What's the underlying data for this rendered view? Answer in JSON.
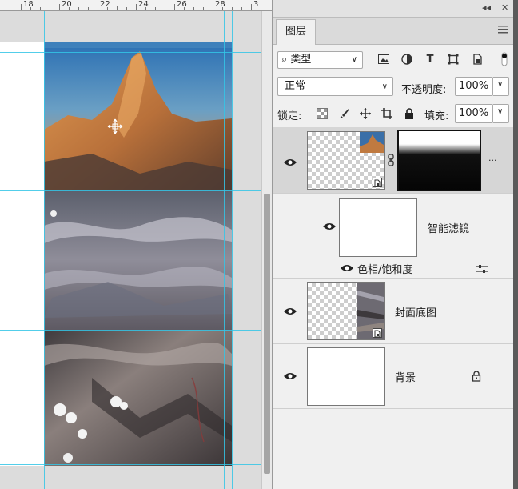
{
  "ruler": {
    "ticks": [
      "18",
      "20",
      "22",
      "24",
      "26",
      "28",
      "3"
    ]
  },
  "panel": {
    "collapse_label": "◂◂",
    "close_label": "✕",
    "tab_label": "图层",
    "filter": {
      "search_symbol": "⌕",
      "value": "类型",
      "type_icon_t": "T"
    },
    "blend": {
      "mode": "正常",
      "opacity_label": "不透明度:",
      "opacity_value": "100%"
    },
    "lock": {
      "label": "锁定:",
      "fill_label": "填充:",
      "fill_value": "100%"
    },
    "layers": [
      {
        "name": "",
        "type": "smart-object-with-mask",
        "selected": true,
        "visible": true,
        "more": "..."
      },
      {
        "name": "智能滤镜",
        "type": "smart-filters-mask",
        "visible": true
      },
      {
        "name": "色相/饱和度",
        "type": "filter-effect",
        "visible": true
      },
      {
        "name": "封面底图",
        "type": "smart-object",
        "visible": true
      },
      {
        "name": "背景",
        "type": "background",
        "visible": true,
        "locked": true
      }
    ]
  },
  "colors": {
    "guide": "#34c6e6",
    "selected_row": "#d6d6d6",
    "panel_bg": "#f0f0f0"
  }
}
